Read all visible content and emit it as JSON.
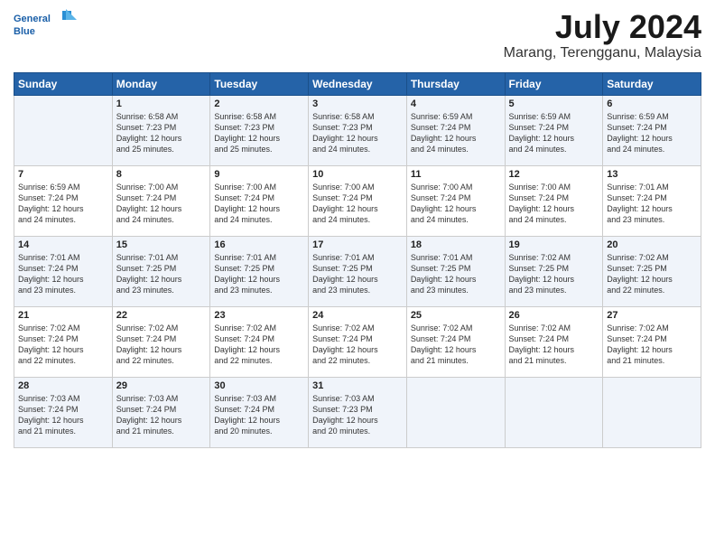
{
  "header": {
    "logo": "GeneralBlue",
    "month": "July 2024",
    "location": "Marang, Terengganu, Malaysia"
  },
  "weekdays": [
    "Sunday",
    "Monday",
    "Tuesday",
    "Wednesday",
    "Thursday",
    "Friday",
    "Saturday"
  ],
  "weeks": [
    [
      {
        "day": "",
        "lines": []
      },
      {
        "day": "1",
        "lines": [
          "Sunrise: 6:58 AM",
          "Sunset: 7:23 PM",
          "Daylight: 12 hours",
          "and 25 minutes."
        ]
      },
      {
        "day": "2",
        "lines": [
          "Sunrise: 6:58 AM",
          "Sunset: 7:23 PM",
          "Daylight: 12 hours",
          "and 25 minutes."
        ]
      },
      {
        "day": "3",
        "lines": [
          "Sunrise: 6:58 AM",
          "Sunset: 7:23 PM",
          "Daylight: 12 hours",
          "and 24 minutes."
        ]
      },
      {
        "day": "4",
        "lines": [
          "Sunrise: 6:59 AM",
          "Sunset: 7:24 PM",
          "Daylight: 12 hours",
          "and 24 minutes."
        ]
      },
      {
        "day": "5",
        "lines": [
          "Sunrise: 6:59 AM",
          "Sunset: 7:24 PM",
          "Daylight: 12 hours",
          "and 24 minutes."
        ]
      },
      {
        "day": "6",
        "lines": [
          "Sunrise: 6:59 AM",
          "Sunset: 7:24 PM",
          "Daylight: 12 hours",
          "and 24 minutes."
        ]
      }
    ],
    [
      {
        "day": "7",
        "lines": [
          "Sunrise: 6:59 AM",
          "Sunset: 7:24 PM",
          "Daylight: 12 hours",
          "and 24 minutes."
        ]
      },
      {
        "day": "8",
        "lines": [
          "Sunrise: 7:00 AM",
          "Sunset: 7:24 PM",
          "Daylight: 12 hours",
          "and 24 minutes."
        ]
      },
      {
        "day": "9",
        "lines": [
          "Sunrise: 7:00 AM",
          "Sunset: 7:24 PM",
          "Daylight: 12 hours",
          "and 24 minutes."
        ]
      },
      {
        "day": "10",
        "lines": [
          "Sunrise: 7:00 AM",
          "Sunset: 7:24 PM",
          "Daylight: 12 hours",
          "and 24 minutes."
        ]
      },
      {
        "day": "11",
        "lines": [
          "Sunrise: 7:00 AM",
          "Sunset: 7:24 PM",
          "Daylight: 12 hours",
          "and 24 minutes."
        ]
      },
      {
        "day": "12",
        "lines": [
          "Sunrise: 7:00 AM",
          "Sunset: 7:24 PM",
          "Daylight: 12 hours",
          "and 24 minutes."
        ]
      },
      {
        "day": "13",
        "lines": [
          "Sunrise: 7:01 AM",
          "Sunset: 7:24 PM",
          "Daylight: 12 hours",
          "and 23 minutes."
        ]
      }
    ],
    [
      {
        "day": "14",
        "lines": [
          "Sunrise: 7:01 AM",
          "Sunset: 7:24 PM",
          "Daylight: 12 hours",
          "and 23 minutes."
        ]
      },
      {
        "day": "15",
        "lines": [
          "Sunrise: 7:01 AM",
          "Sunset: 7:25 PM",
          "Daylight: 12 hours",
          "and 23 minutes."
        ]
      },
      {
        "day": "16",
        "lines": [
          "Sunrise: 7:01 AM",
          "Sunset: 7:25 PM",
          "Daylight: 12 hours",
          "and 23 minutes."
        ]
      },
      {
        "day": "17",
        "lines": [
          "Sunrise: 7:01 AM",
          "Sunset: 7:25 PM",
          "Daylight: 12 hours",
          "and 23 minutes."
        ]
      },
      {
        "day": "18",
        "lines": [
          "Sunrise: 7:01 AM",
          "Sunset: 7:25 PM",
          "Daylight: 12 hours",
          "and 23 minutes."
        ]
      },
      {
        "day": "19",
        "lines": [
          "Sunrise: 7:02 AM",
          "Sunset: 7:25 PM",
          "Daylight: 12 hours",
          "and 23 minutes."
        ]
      },
      {
        "day": "20",
        "lines": [
          "Sunrise: 7:02 AM",
          "Sunset: 7:25 PM",
          "Daylight: 12 hours",
          "and 22 minutes."
        ]
      }
    ],
    [
      {
        "day": "21",
        "lines": [
          "Sunrise: 7:02 AM",
          "Sunset: 7:24 PM",
          "Daylight: 12 hours",
          "and 22 minutes."
        ]
      },
      {
        "day": "22",
        "lines": [
          "Sunrise: 7:02 AM",
          "Sunset: 7:24 PM",
          "Daylight: 12 hours",
          "and 22 minutes."
        ]
      },
      {
        "day": "23",
        "lines": [
          "Sunrise: 7:02 AM",
          "Sunset: 7:24 PM",
          "Daylight: 12 hours",
          "and 22 minutes."
        ]
      },
      {
        "day": "24",
        "lines": [
          "Sunrise: 7:02 AM",
          "Sunset: 7:24 PM",
          "Daylight: 12 hours",
          "and 22 minutes."
        ]
      },
      {
        "day": "25",
        "lines": [
          "Sunrise: 7:02 AM",
          "Sunset: 7:24 PM",
          "Daylight: 12 hours",
          "and 21 minutes."
        ]
      },
      {
        "day": "26",
        "lines": [
          "Sunrise: 7:02 AM",
          "Sunset: 7:24 PM",
          "Daylight: 12 hours",
          "and 21 minutes."
        ]
      },
      {
        "day": "27",
        "lines": [
          "Sunrise: 7:02 AM",
          "Sunset: 7:24 PM",
          "Daylight: 12 hours",
          "and 21 minutes."
        ]
      }
    ],
    [
      {
        "day": "28",
        "lines": [
          "Sunrise: 7:03 AM",
          "Sunset: 7:24 PM",
          "Daylight: 12 hours",
          "and 21 minutes."
        ]
      },
      {
        "day": "29",
        "lines": [
          "Sunrise: 7:03 AM",
          "Sunset: 7:24 PM",
          "Daylight: 12 hours",
          "and 21 minutes."
        ]
      },
      {
        "day": "30",
        "lines": [
          "Sunrise: 7:03 AM",
          "Sunset: 7:24 PM",
          "Daylight: 12 hours",
          "and 20 minutes."
        ]
      },
      {
        "day": "31",
        "lines": [
          "Sunrise: 7:03 AM",
          "Sunset: 7:23 PM",
          "Daylight: 12 hours",
          "and 20 minutes."
        ]
      },
      {
        "day": "",
        "lines": []
      },
      {
        "day": "",
        "lines": []
      },
      {
        "day": "",
        "lines": []
      }
    ]
  ]
}
